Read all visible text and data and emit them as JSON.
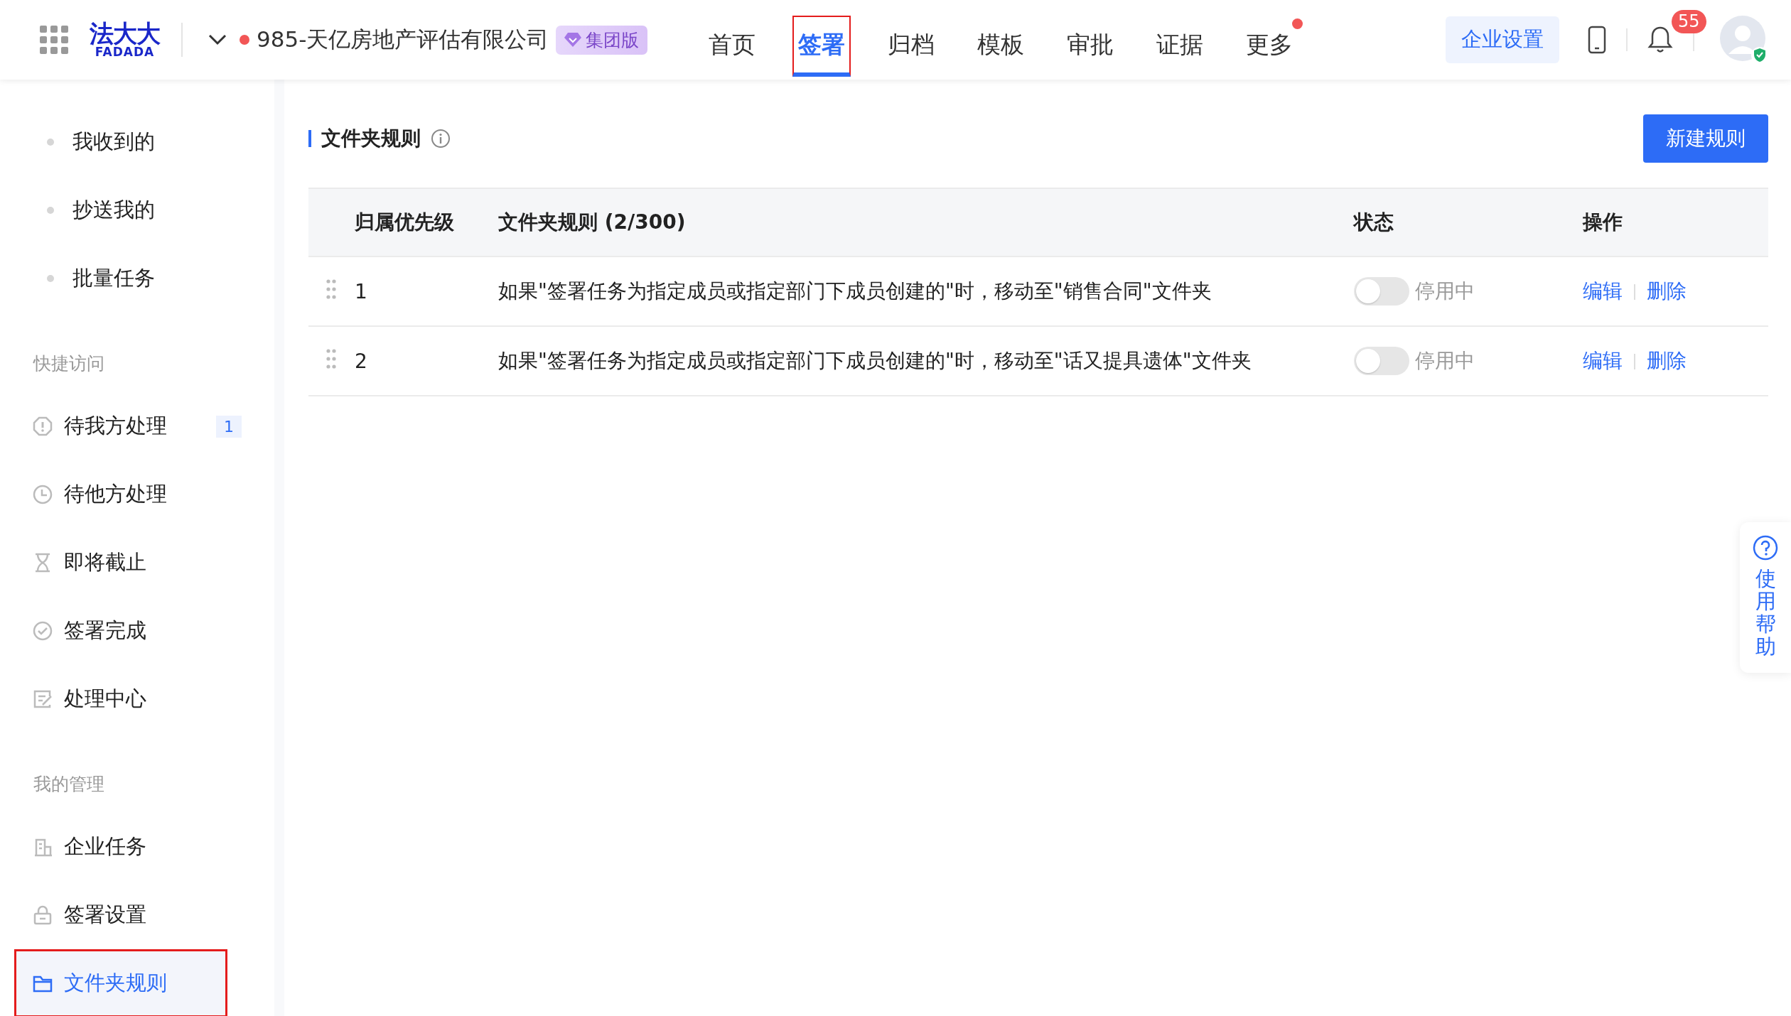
{
  "header": {
    "logo": {
      "mark": "法大大",
      "wordmark": "FADADA"
    },
    "company": "985-天亿房地产评估有限公司",
    "plan_badge": "集团版",
    "nav": [
      {
        "label": "首页",
        "selected": false,
        "outlined": false,
        "dot": false
      },
      {
        "label": "签署",
        "selected": true,
        "outlined": true,
        "dot": false
      },
      {
        "label": "归档",
        "selected": false,
        "outlined": false,
        "dot": false
      },
      {
        "label": "模板",
        "selected": false,
        "outlined": false,
        "dot": false
      },
      {
        "label": "审批",
        "selected": false,
        "outlined": false,
        "dot": false
      },
      {
        "label": "证据",
        "selected": false,
        "outlined": false,
        "dot": false
      },
      {
        "label": "更多",
        "selected": false,
        "outlined": false,
        "dot": true
      }
    ],
    "settings_button": "企业设置",
    "notifications": "55"
  },
  "sidebar": {
    "sections": [
      {
        "items": [
          {
            "kind": "bullet",
            "label": "我收到的",
            "selected": false,
            "outlined": false
          },
          {
            "kind": "bullet",
            "label": "抄送我的",
            "selected": false,
            "outlined": false
          },
          {
            "kind": "bullet",
            "label": "批量任务",
            "selected": false,
            "outlined": false
          }
        ]
      },
      {
        "title": "快捷访问",
        "items": [
          {
            "kind": "alert",
            "label": "待我方处理",
            "selected": false,
            "outlined": false,
            "badge": "1"
          },
          {
            "kind": "clock",
            "label": "待他方处理",
            "selected": false,
            "outlined": false
          },
          {
            "kind": "hourglass",
            "label": "即将截止",
            "selected": false,
            "outlined": false
          },
          {
            "kind": "check",
            "label": "签署完成",
            "selected": false,
            "outlined": false
          },
          {
            "kind": "edit",
            "label": "处理中心",
            "selected": false,
            "outlined": false
          }
        ]
      },
      {
        "title": "我的管理",
        "items": [
          {
            "kind": "building",
            "label": "企业任务",
            "selected": false,
            "outlined": false
          },
          {
            "kind": "lock",
            "label": "签署设置",
            "selected": false,
            "outlined": false
          },
          {
            "kind": "folder",
            "label": "文件夹规则",
            "selected": true,
            "outlined": true
          }
        ]
      }
    ]
  },
  "content": {
    "title": "文件夹规则",
    "new_button": "新建规则",
    "table": {
      "columns": [
        "归属优先级",
        "文件夹规则 (2/300)",
        "状态",
        "操作"
      ],
      "rows": [
        {
          "priority": "1",
          "rule": "如果\"签署任务为指定成员或指定部门下成员创建的\"时，移动至\"销售合同\"文件夹",
          "enabled": false,
          "status": "停用中",
          "actions": [
            "编辑",
            "删除"
          ]
        },
        {
          "priority": "2",
          "rule": "如果\"签署任务为指定成员或指定部门下成员创建的\"时，移动至\"话又提具遗体\"文件夹",
          "enabled": false,
          "status": "停用中",
          "actions": [
            "编辑",
            "删除"
          ]
        }
      ]
    }
  },
  "help": {
    "label": "使用帮助"
  }
}
